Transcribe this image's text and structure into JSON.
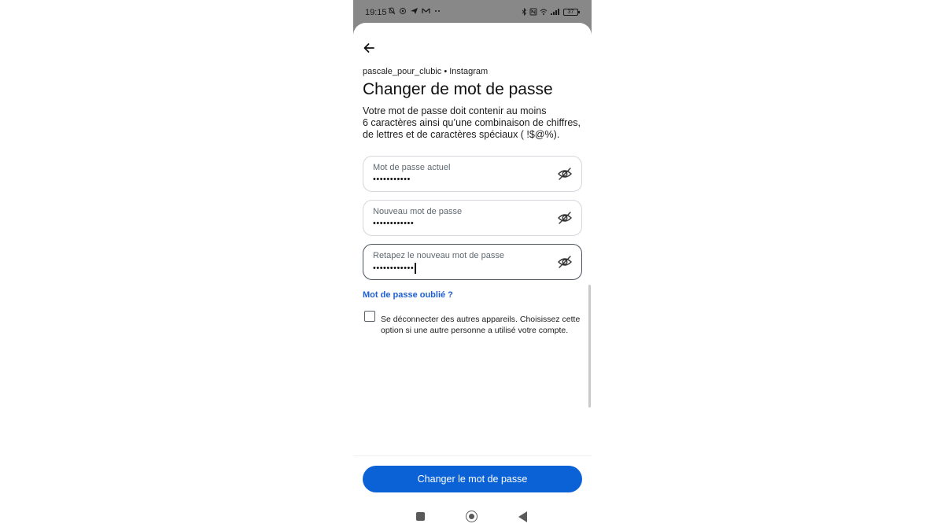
{
  "status_bar": {
    "time": "19:15",
    "left_icons": [
      "muted-bell-icon",
      "alert-icon",
      "navigation-icon",
      "gmail-icon",
      "more-dots-icon"
    ],
    "right_icons": [
      "bluetooth-icon",
      "nfc-icon",
      "wifi-icon",
      "signal-icon"
    ],
    "battery": "37"
  },
  "header": {
    "back_icon": "back-arrow-icon",
    "account": "pascale_pour_clubic • Instagram",
    "title": "Changer de mot de passe"
  },
  "description": {
    "lines": [
      "Votre mot de passe doit contenir au moins",
      "6 caractères ainsi qu’une combinaison de chiffres,",
      "de lettres et de caractères spéciaux ( !$@%)."
    ]
  },
  "fields": [
    {
      "label": "Mot de passe actuel",
      "value": "•••••••••••",
      "icon": "eye-hidden-icon"
    },
    {
      "label": "Nouveau mot de passe",
      "value": "••••••••••••",
      "icon": "eye-hidden-icon"
    },
    {
      "label": "Retapez le nouveau mot de passe",
      "value": "••••••••••••",
      "icon": "eye-hidden-icon"
    }
  ],
  "forgot_link": "Mot de passe oublié ?",
  "logout_option": {
    "checked": false,
    "lines": [
      "Se déconnecter des autres appareils. Choisissez cette",
      "option si une autre personne a utilisé votre compte."
    ]
  },
  "submit_button": "Changer le mot de passe",
  "colors": {
    "accent": "#0b62d6",
    "link": "#1f5fd1",
    "status_bar": "#888888"
  }
}
